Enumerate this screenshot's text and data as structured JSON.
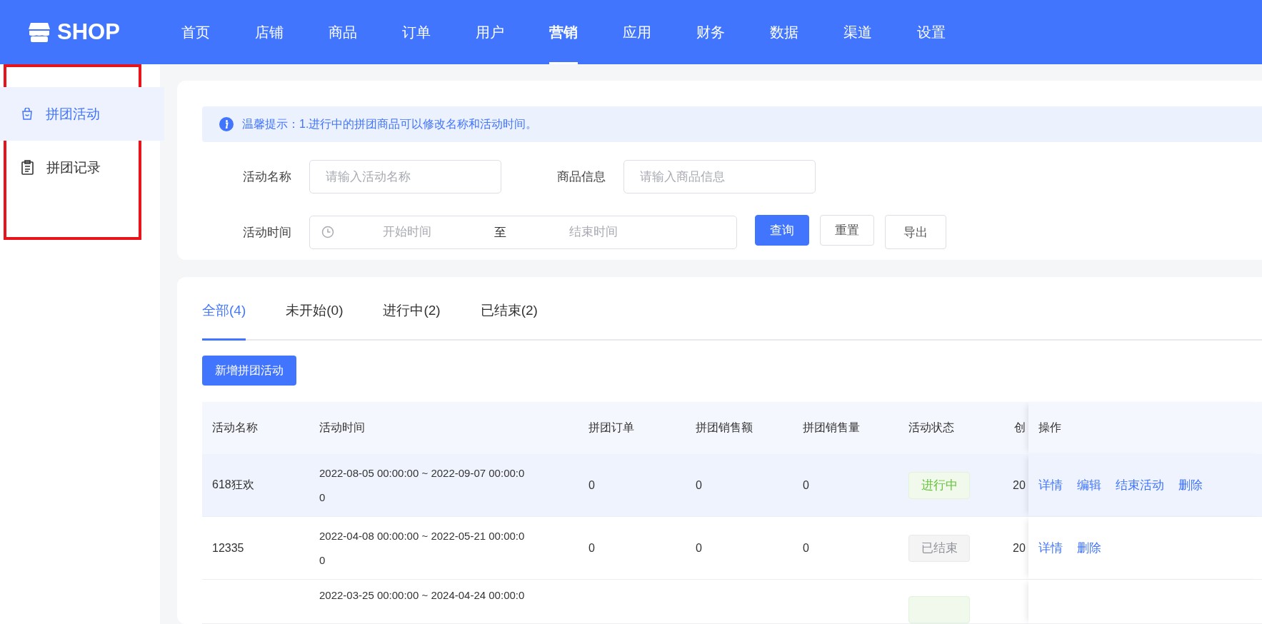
{
  "header": {
    "logo": "SHOP",
    "nav": [
      {
        "label": "首页",
        "selected": false
      },
      {
        "label": "店铺",
        "selected": false
      },
      {
        "label": "商品",
        "selected": false
      },
      {
        "label": "订单",
        "selected": false
      },
      {
        "label": "用户",
        "selected": false
      },
      {
        "label": "营销",
        "selected": true
      },
      {
        "label": "应用",
        "selected": false
      },
      {
        "label": "财务",
        "selected": false
      },
      {
        "label": "数据",
        "selected": false
      },
      {
        "label": "渠道",
        "selected": false
      },
      {
        "label": "设置",
        "selected": false
      }
    ]
  },
  "sidebar": {
    "highlighted": true,
    "items": [
      {
        "label": "拼团活动",
        "selected": true
      },
      {
        "label": "拼团记录",
        "selected": false
      }
    ]
  },
  "notice": {
    "text": "温馨提示：1.进行中的拼团商品可以修改名称和活动时间。"
  },
  "filters": {
    "fields": [
      {
        "label": "活动名称",
        "placeholder": "请输入活动名称"
      },
      {
        "label": "商品信息",
        "placeholder": "请输入商品信息"
      }
    ],
    "date_range": {
      "label": "活动时间",
      "start_placeholder": "开始时间",
      "separator": "至",
      "end_placeholder": "结束时间"
    },
    "buttons": [
      {
        "label": "查询",
        "kind": "primary"
      },
      {
        "label": "重置",
        "kind": "default"
      },
      {
        "label": "导出",
        "kind": "default"
      }
    ]
  },
  "tabs": [
    {
      "label": "全部(4)",
      "selected": true
    },
    {
      "label": "未开始(0)",
      "selected": false
    },
    {
      "label": "进行中(2)",
      "selected": false
    },
    {
      "label": "已结束(2)",
      "selected": false
    }
  ],
  "add_button": "新增拼团活动",
  "table": {
    "columns": [
      "活动名称",
      "活动时间",
      "拼团订单",
      "拼团销售额",
      "拼团销售量",
      "活动状态",
      "创",
      "操作"
    ],
    "rows": [
      {
        "name": "618狂欢",
        "time": "2022-08-05 00:00:00 ~ 2022-09-07 00:00:00",
        "orders": "0",
        "sales_amount": "0",
        "sales_volume": "0",
        "status": {
          "label": "进行中",
          "kind": "ongoing"
        },
        "created": "20",
        "actions": [
          "详情",
          "编辑",
          "结束活动",
          "删除"
        ],
        "hovered": true
      },
      {
        "name": "12335",
        "time": "2022-04-08 00:00:00 ~ 2022-05-21 00:00:00",
        "orders": "0",
        "sales_amount": "0",
        "sales_volume": "0",
        "status": {
          "label": "已结束",
          "kind": "ended"
        },
        "created": "20",
        "actions": [
          "详情",
          "删除"
        ],
        "hovered": false
      },
      {
        "time": "2022-03-25 00:00:00 ~ 2024-04-24 00:00:0",
        "status": {
          "kind": "ongoing"
        }
      }
    ]
  }
}
